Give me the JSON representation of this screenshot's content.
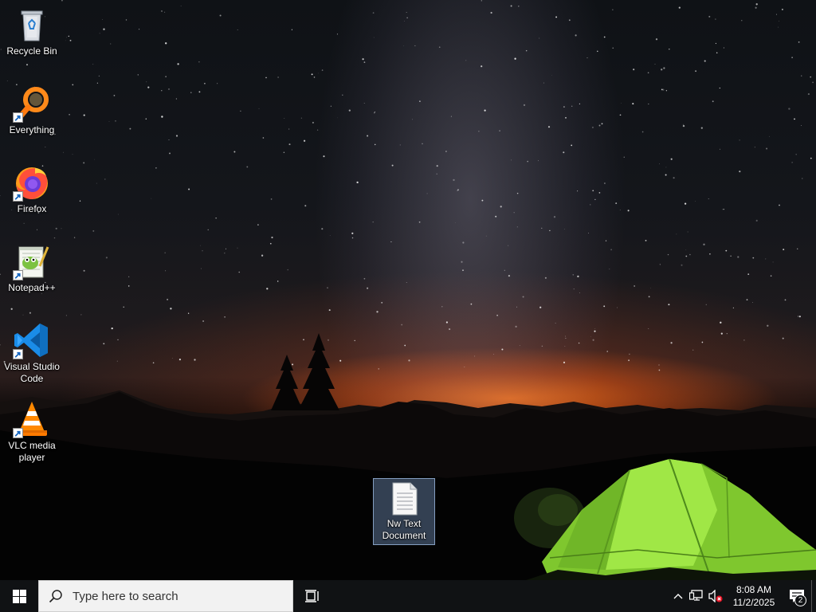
{
  "desktop": {
    "icons": [
      {
        "label": "Recycle Bin",
        "icon": "recycle-bin-icon"
      },
      {
        "label": "Everything",
        "icon": "everything-search-icon"
      },
      {
        "label": "Firefox",
        "icon": "firefox-icon"
      },
      {
        "label": "Notepad++",
        "icon": "notepad-plus-plus-icon"
      },
      {
        "label": "Visual Studio Code",
        "icon": "vscode-icon"
      },
      {
        "label": "VLC media player",
        "icon": "vlc-icon"
      },
      {
        "label": "Nw Text Document",
        "icon": "text-document-icon"
      }
    ]
  },
  "taskbar": {
    "search_placeholder": "Type here to search",
    "clock_time": "8:08 AM",
    "clock_date": "11/2/2025",
    "notification_count": "2"
  },
  "colors": {
    "taskbar_bg": "#101214",
    "tent_green": "#8fd63a",
    "horizon_orange": "#ff7a1e",
    "vscode_blue": "#0f7fd8",
    "selection_blue": "#6e8cb4"
  }
}
